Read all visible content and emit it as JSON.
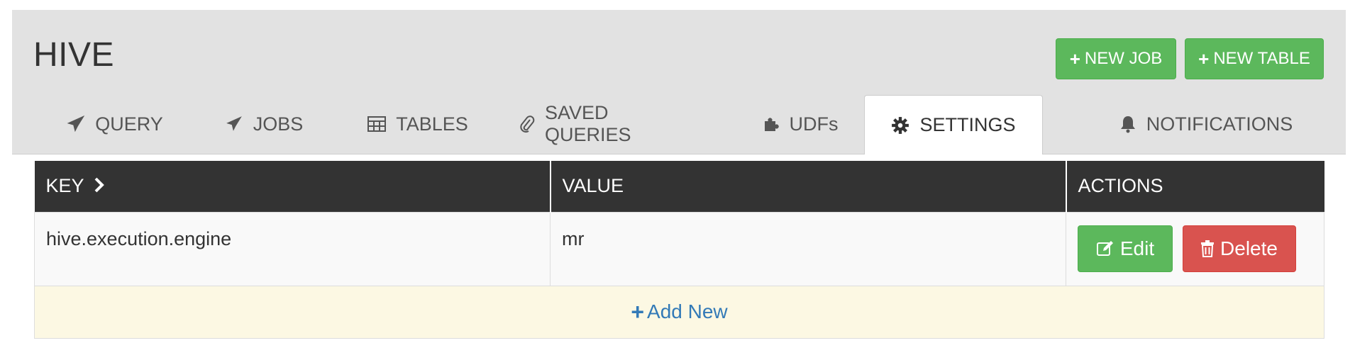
{
  "app": {
    "title": "HIVE"
  },
  "header_buttons": {
    "new_job": "NEW JOB",
    "new_table": "NEW TABLE"
  },
  "tabs": [
    {
      "label": "QUERY",
      "icon": "paper-plane-icon"
    },
    {
      "label": "JOBS",
      "icon": "paper-plane-icon"
    },
    {
      "label": "TABLES",
      "icon": "table-icon"
    },
    {
      "label": "SAVED QUERIES",
      "icon": "paperclip-icon"
    },
    {
      "label": "UDFs",
      "icon": "puzzle-icon"
    },
    {
      "label": "SETTINGS",
      "icon": "gear-icon",
      "active": true
    },
    {
      "label": "NOTIFICATIONS",
      "icon": "bell-icon"
    }
  ],
  "table": {
    "headers": {
      "key": "KEY",
      "value": "VALUE",
      "actions": "ACTIONS"
    },
    "rows": [
      {
        "key": "hive.execution.engine",
        "value": "mr"
      }
    ],
    "edit_label": "Edit",
    "delete_label": "Delete",
    "add_new_label": "Add New"
  },
  "colors": {
    "success": "#5cb85c",
    "danger": "#d9534f",
    "link": "#337ab7",
    "header_bg": "#333333",
    "panel_bg": "#e2e2e2",
    "warning_row": "#fcf8e3"
  }
}
